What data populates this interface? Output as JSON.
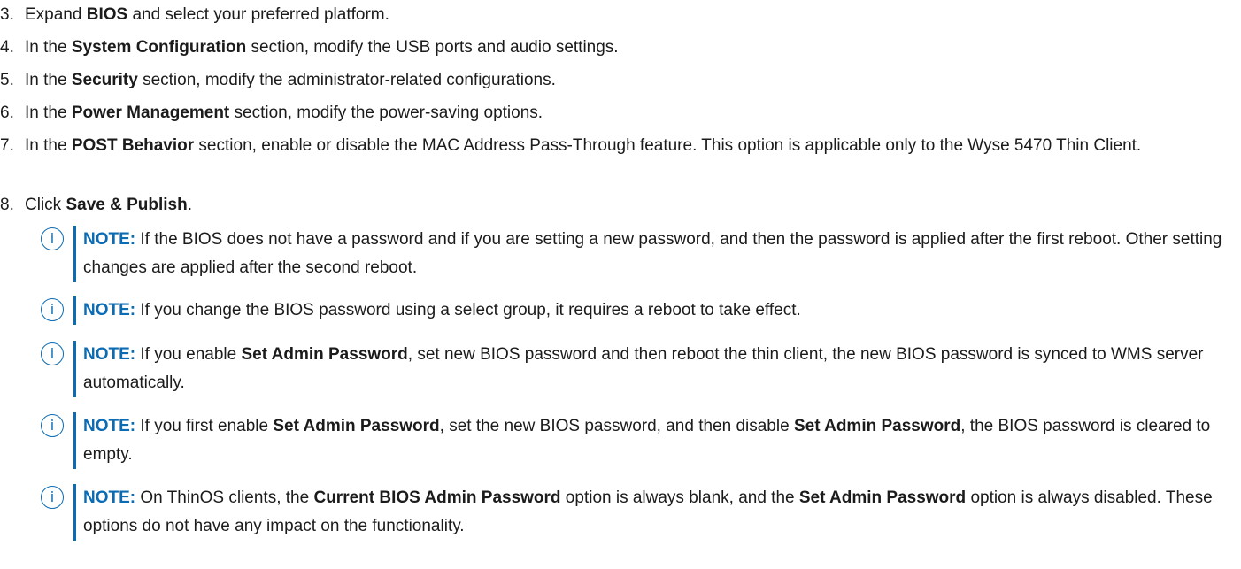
{
  "steps": [
    {
      "num": "3.",
      "parts": [
        {
          "t": "Expand "
        },
        {
          "b": "BIOS"
        },
        {
          "t": " and select your preferred platform."
        }
      ]
    },
    {
      "num": "4.",
      "parts": [
        {
          "t": "In the "
        },
        {
          "b": "System Configuration"
        },
        {
          "t": " section, modify the USB ports and audio settings."
        }
      ]
    },
    {
      "num": "5.",
      "parts": [
        {
          "t": "In the "
        },
        {
          "b": "Security"
        },
        {
          "t": " section, modify the administrator-related configurations."
        }
      ]
    },
    {
      "num": "6.",
      "parts": [
        {
          "t": "In the "
        },
        {
          "b": "Power Management"
        },
        {
          "t": " section, modify the power-saving options."
        }
      ]
    },
    {
      "num": "7.",
      "parts": [
        {
          "t": "In the "
        },
        {
          "b": "POST Behavior"
        },
        {
          "t": " section, enable or disable the MAC Address Pass-Through feature. This option is applicable only to the Wyse 5470 Thin Client."
        }
      ]
    },
    {
      "num": "8.",
      "parts": [
        {
          "t": "Click "
        },
        {
          "b": "Save & Publish"
        },
        {
          "t": "."
        }
      ]
    }
  ],
  "notes": [
    {
      "label": "NOTE:",
      "icon": "info-icon",
      "parts": [
        {
          "t": " If the BIOS does not have a password and if you are setting a new password, and then the password is applied after the first reboot. Other setting changes are applied after the second reboot."
        }
      ]
    },
    {
      "label": "NOTE:",
      "icon": "info-icon",
      "parts": [
        {
          "t": " If you change the BIOS password using a select group, it requires a reboot to take effect."
        }
      ]
    },
    {
      "label": "NOTE:",
      "icon": "info-icon",
      "parts": [
        {
          "t": " If you enable "
        },
        {
          "b": "Set Admin Password"
        },
        {
          "t": ", set new BIOS password and then reboot the thin client, the new BIOS password is synced to WMS server automatically."
        }
      ]
    },
    {
      "label": "NOTE:",
      "icon": "info-icon",
      "parts": [
        {
          "t": " If you first enable "
        },
        {
          "b": "Set Admin Password"
        },
        {
          "t": ", set the new BIOS password, and then disable "
        },
        {
          "b": "Set Admin Password"
        },
        {
          "t": ", the BIOS password is cleared to empty."
        }
      ]
    },
    {
      "label": "NOTE:",
      "icon": "info-icon",
      "parts": [
        {
          "t": " On ThinOS clients, the "
        },
        {
          "b": "Current BIOS Admin Password"
        },
        {
          "t": " option is always blank, and the "
        },
        {
          "b": "Set Admin Password"
        },
        {
          "t": " option is always disabled. These options do not have any impact on the functionality."
        }
      ]
    }
  ],
  "icon_glyph": "i",
  "colors": {
    "accent": "#0b6cb4",
    "text": "#1b1b1b"
  }
}
